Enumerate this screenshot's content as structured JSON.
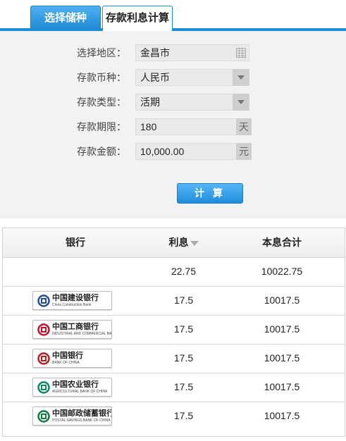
{
  "tabs": [
    {
      "label": "选择储种",
      "active": false
    },
    {
      "label": "存款利息计算",
      "active": true
    }
  ],
  "form": {
    "region": {
      "label": "选择地区：",
      "value": "金昌市"
    },
    "currency": {
      "label": "存款币种：",
      "value": "人民币"
    },
    "deposit_type": {
      "label": "存款类型：",
      "value": "活期"
    },
    "term": {
      "label": "存款期限：",
      "value": "180",
      "unit": "天"
    },
    "amount": {
      "label": "存款金额：",
      "value": "10,000.00",
      "unit": "元"
    },
    "calculate_label": "计 算"
  },
  "table": {
    "headers": {
      "bank": "银行",
      "interest": "利息",
      "total": "本息合计"
    },
    "summary_row": {
      "interest": "22.75",
      "total": "10022.75"
    },
    "rows": [
      {
        "bank_name": "中国建设银行",
        "bank_sub": "China Construction Bank",
        "logo_color": "#1f4f9b",
        "interest": "17.5",
        "total": "10017.5"
      },
      {
        "bank_name": "中国工商银行",
        "bank_sub": "INDUSTRIAL AND COMMERCIAL BANK OF CHINA",
        "logo_color": "#c8102e",
        "interest": "17.5",
        "total": "10017.5"
      },
      {
        "bank_name": "中国银行",
        "bank_sub": "BANK OF CHINA",
        "logo_color": "#b81c22",
        "interest": "17.5",
        "total": "10017.5"
      },
      {
        "bank_name": "中国农业银行",
        "bank_sub": "AGRICULTURAL BANK OF CHINA",
        "logo_color": "#0a8a5b",
        "interest": "17.5",
        "total": "10017.5"
      },
      {
        "bank_name": "中国邮政储蓄银行",
        "bank_sub": "POSTAL SAVINGS BANK OF CHINA",
        "logo_color": "#0a7a3f",
        "interest": "17.5",
        "total": "10017.5"
      }
    ]
  },
  "colors": {
    "accent": "#1b8fdc",
    "panel": "#f2f2f2"
  }
}
